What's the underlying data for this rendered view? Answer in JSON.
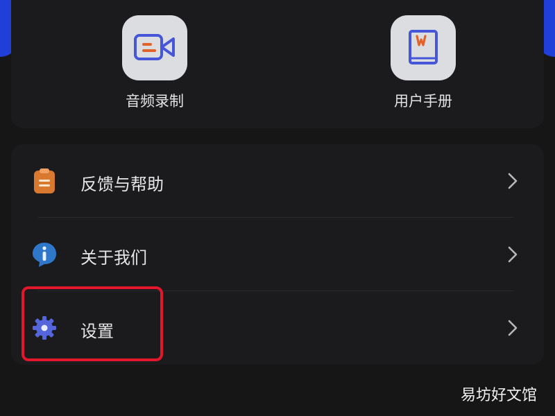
{
  "tools": [
    {
      "label": "音频录制",
      "icon": "video-camera-icon"
    },
    {
      "label": "用户手册",
      "icon": "book-icon"
    }
  ],
  "menu": [
    {
      "label": "反馈与帮助",
      "icon": "clipboard-icon"
    },
    {
      "label": "关于我们",
      "icon": "info-icon"
    },
    {
      "label": "设置",
      "icon": "gear-icon"
    }
  ],
  "watermark": "易坊好文馆",
  "colors": {
    "background": "#161617",
    "card": "#1b1b1d",
    "accent_blue": "#1f3fd8",
    "highlight_red": "#e3162b",
    "clipboard_orange": "#d9782f",
    "gear_blue": "#5566dd",
    "info_blue": "#2f78c9"
  }
}
